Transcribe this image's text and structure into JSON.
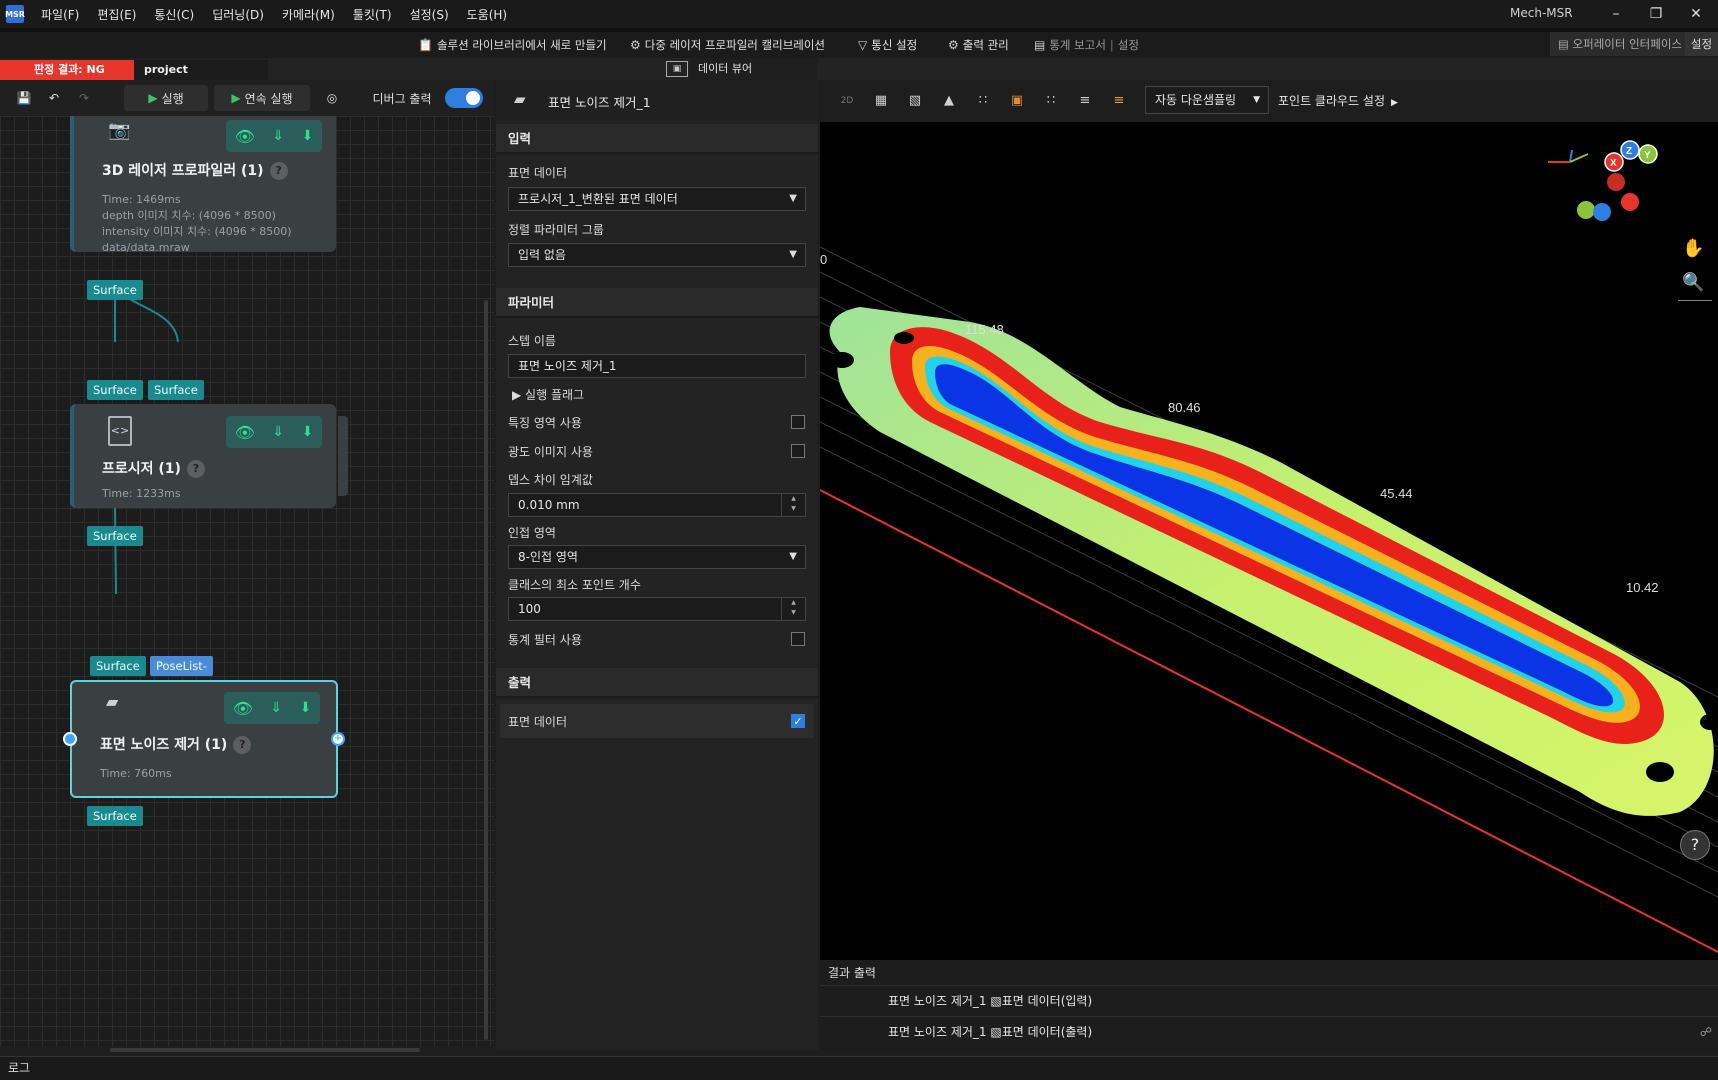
{
  "menu": {
    "items": [
      "파일(F)",
      "편집(E)",
      "통신(C)",
      "딥러닝(D)",
      "카메라(M)",
      "툴킷(T)",
      "설정(S)",
      "도움(H)"
    ],
    "app_name": "Mech-MSR"
  },
  "toolbar": {
    "new_from_library": "솔루션 라이브러리에서 새로 만들기",
    "multi_calibration": "다중 레이저 프로파일러 캘리브레이션",
    "comm_settings": "통신 설정",
    "output_manage": "출력 관리",
    "stats_report": "통계 보고서",
    "settings_inline": "설정",
    "operator_interface": "오퍼레이터 인터페이스",
    "settings": "설정"
  },
  "tabs": {
    "verdict": "판정 결과: NG",
    "project": "project",
    "data_viewer": "데이터 뷰어"
  },
  "flow_toolbar": {
    "run": "실행",
    "continuous_run": "연속 실행",
    "debug_output": "디버그 출력"
  },
  "nodes": {
    "laser": {
      "title": "3D 레이저 프로파일러 (1)",
      "info1": "Time: 1469ms",
      "info2": "depth 이미지 치수: (4096 * 8500)",
      "info3": "intensity 이미지 치수: (4096 * 8500)",
      "info4": "data/data.mraw",
      "out_port": "Surface"
    },
    "procedure": {
      "in_port1": "Surface",
      "in_port2": "Surface",
      "title": "프로시저 (1)",
      "info1": "Time: 1233ms",
      "out_port": "Surface"
    },
    "noise": {
      "in_port1": "Surface",
      "in_port2": "PoseList-",
      "title": "표면 노이즈 제거 (1)",
      "info1": "Time: 760ms",
      "out_port": "Surface"
    }
  },
  "props": {
    "step_title": "표면 노이즈 제거_1",
    "input_header": "입력",
    "surface_data_label": "표면 데이터",
    "surface_data_value": "프로시저_1_변환된 표면 데이터",
    "align_group_label": "정렬 파라미터 그룹",
    "align_group_value": "입력 없음",
    "param_header": "파라미터",
    "step_name_label": "스텝 이름",
    "step_name_value": "표면 노이즈 제거_1",
    "exec_flag": "실행 플래그",
    "feature_region": "특징 영역 사용",
    "intensity_image": "광도 이미지 사용",
    "depth_threshold_label": "뎁스 차이 임계값",
    "depth_threshold_value": "0.010 mm",
    "neighbor_label": "인접 영역",
    "neighbor_value": "8-인접 영역",
    "min_points_label": "클래스의 최소 포인트 개수",
    "min_points_value": "100",
    "stat_filter": "통계 필터 사용",
    "output_header": "출력",
    "output_surface": "표면 데이터"
  },
  "viewer": {
    "downsample": "자동 다운샘플링",
    "point_cloud_settings": "포인트 클라우드 설정",
    "tool_2d": "2D",
    "axis_labels": [
      "X",
      "Z",
      "Y"
    ],
    "depth_labels": [
      "0",
      "115.48",
      "80.46",
      "45.44",
      "10.42"
    ],
    "help": "?"
  },
  "results": {
    "title": "결과 출력",
    "rows": [
      "표면 노이즈 제거_1 ▧표면 데이터(입력)",
      "표면 노이즈 제거_1 ▧표면 데이터(출력)"
    ]
  },
  "log": "로그"
}
